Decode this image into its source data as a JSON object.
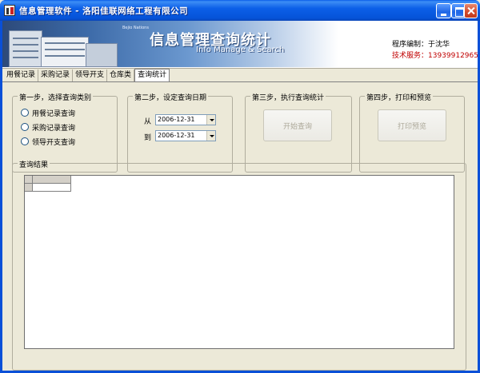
{
  "window": {
    "title": "信息管理软件 - 洛阳佳联网络工程有限公司"
  },
  "banner": {
    "small_text": "Bejio Nations",
    "title": "信息管理查询统计",
    "subtitle": "Info Manage & Search",
    "developer": "程序编制：于沈华",
    "tech_support": "技术服务：13939912965"
  },
  "tabs": [
    {
      "label": "用餐记录"
    },
    {
      "label": "采购记录"
    },
    {
      "label": "领导开支"
    },
    {
      "label": "仓库类"
    },
    {
      "label": "查询统计"
    }
  ],
  "step1": {
    "title": "第一步，选择查询类别",
    "options": [
      "用餐记录查询",
      "采购记录查询",
      "领导开支查询"
    ]
  },
  "step2": {
    "title": "第二步，设定查询日期",
    "from_label": "从",
    "to_label": "到",
    "from_value": "2006-12-31",
    "to_value": "2006-12-31"
  },
  "step3": {
    "title": "第三步，执行查询统计",
    "button_label": "开始查询"
  },
  "step4": {
    "title": "第四步，打印和预览",
    "button_label": "打印预览"
  },
  "results": {
    "title": "查询结果"
  },
  "colors": {
    "titlebar": "#0a5de9",
    "tech_support_text": "#c00000",
    "dialog_bg": "#ece9d8"
  }
}
